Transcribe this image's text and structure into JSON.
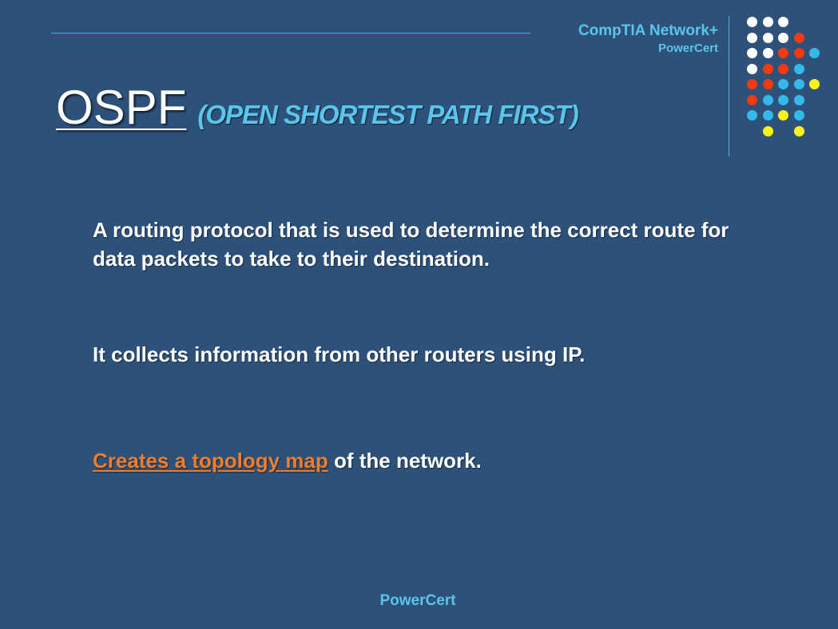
{
  "header": {
    "course": "CompTIA Network+",
    "company": "PowerCert"
  },
  "title": {
    "acronym": "OSPF",
    "expansion": "(OPEN SHORTEST PATH FIRST)"
  },
  "body": {
    "paragraph_1": "A routing protocol that is used to determine the correct route for data packets to take to their destination.",
    "paragraph_2": "It collects information from other routers using IP.",
    "paragraph_3_link": "Creates a topology map",
    "paragraph_3_rest": " of the network."
  },
  "footer": {
    "brand": "PowerCert"
  },
  "colors": {
    "background": "#2d5179",
    "accent_blue": "#5ac4ea",
    "link_orange": "#f07d2e",
    "dot_white": "#ffffff",
    "dot_red": "#f23a12",
    "dot_blue": "#34b9ea",
    "dot_yellow": "#fbf21b"
  }
}
